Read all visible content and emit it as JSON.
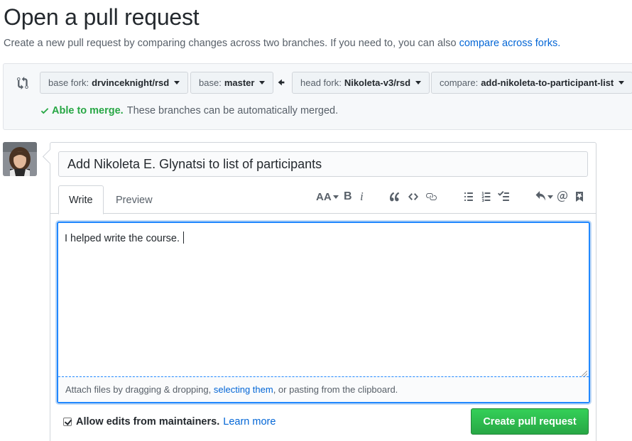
{
  "header": {
    "title": "Open a pull request",
    "subtitle": "Create a new pull request by comparing changes across two branches. If you need to, you can also",
    "compare_link": "compare across forks."
  },
  "range": {
    "base_fork_label": "base fork:",
    "base_fork_value": "drvinceknight/rsd",
    "base_label": "base:",
    "base_value": "master",
    "head_fork_label": "head fork:",
    "head_fork_value": "Nikoleta-v3/rsd",
    "compare_label": "compare:",
    "compare_value": "add-nikoleta-to-participant-list",
    "merge_ok": "Able to merge.",
    "merge_msg": "These branches can be automatically merged."
  },
  "form": {
    "title_value": "Add Nikoleta E. Glynatsi to list of participants",
    "tabs": {
      "write": "Write",
      "preview": "Preview"
    },
    "toolbar": {
      "header": "AA",
      "bold": "B",
      "italic": "i"
    },
    "body_text": "I helped write the course.",
    "attach_prefix": "Attach files by dragging & dropping,",
    "attach_link": "selecting them",
    "attach_suffix": ", or pasting from the clipboard.",
    "allow_edits": "Allow edits from maintainers.",
    "learn_more": "Learn more",
    "submit": "Create pull request"
  },
  "colors": {
    "link": "#0366d6",
    "success": "#28a745",
    "focus": "#2188ff"
  }
}
